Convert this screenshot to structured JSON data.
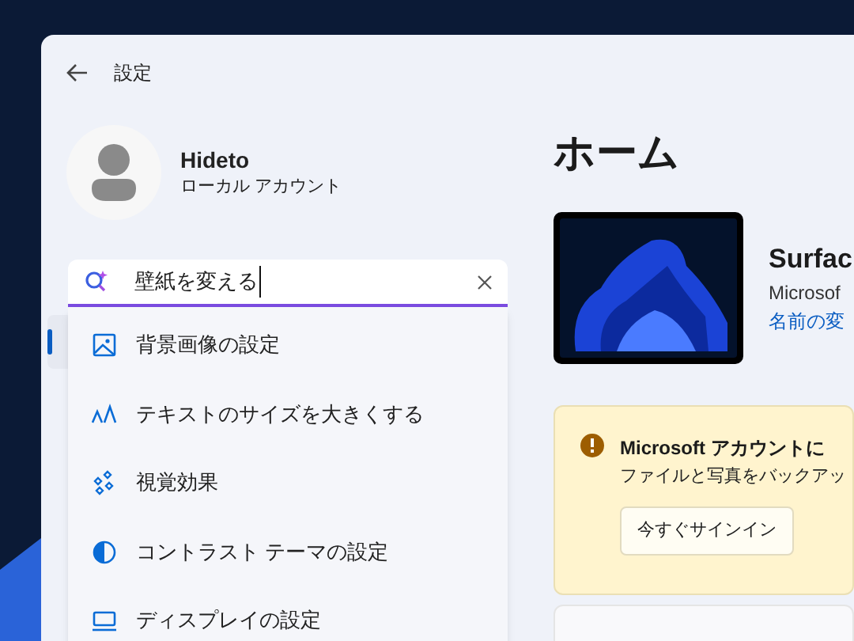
{
  "window": {
    "title": "設定"
  },
  "account": {
    "name": "Hideto",
    "type": "ローカル アカウント"
  },
  "search": {
    "value": "壁紙を変える",
    "suggestions": [
      {
        "kind": "picture",
        "label": "背景画像の設定"
      },
      {
        "kind": "text-size",
        "label": "テキストのサイズを大きくする"
      },
      {
        "kind": "sparkle",
        "label": "視覚効果"
      },
      {
        "kind": "contrast",
        "label": "コントラスト テーマの設定"
      },
      {
        "kind": "display",
        "label": "ディスプレイの設定"
      }
    ]
  },
  "nav": [
    {
      "selected": true
    }
  ],
  "page": {
    "heading": "ホーム",
    "device": {
      "name": "Surfac",
      "model": "Microsof",
      "rename_link": "名前の変"
    },
    "notice": {
      "title": "Microsoft アカウントに",
      "text": "ファイルと写真をバックアッ",
      "button": "今すぐサインイン"
    }
  }
}
